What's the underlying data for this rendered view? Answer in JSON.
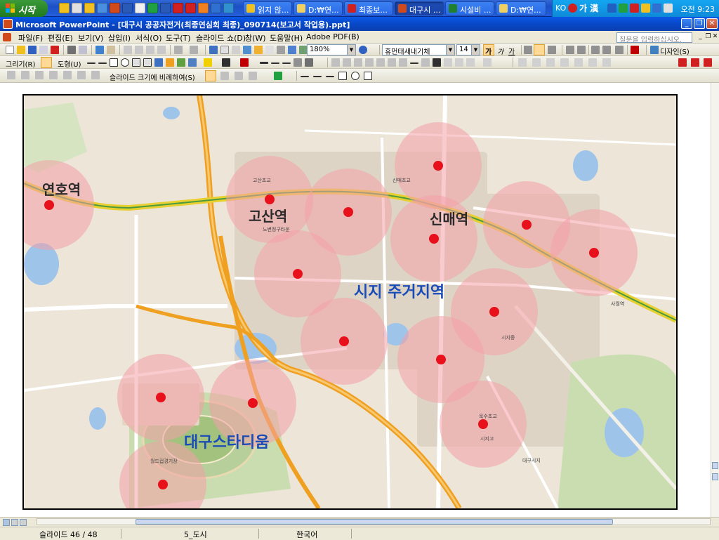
{
  "taskbar": {
    "start_label": "시작",
    "buttons": [
      {
        "label": "읽지 않...",
        "active": false,
        "color": "#f0c020"
      },
      {
        "label": "D:₩연...",
        "active": false,
        "color": "#f0d060"
      },
      {
        "label": "최종보...",
        "active": false,
        "color": "#d02020"
      },
      {
        "label": "대구시 ...",
        "active": true,
        "color": "#d04a1c"
      },
      {
        "label": "시설비 ...",
        "active": false,
        "color": "#208030"
      },
      {
        "label": "D:₩연...",
        "active": false,
        "color": "#f0d060"
      }
    ],
    "ime_label": "KO",
    "ime_mode": "가 漢",
    "clock": "오전 9:23"
  },
  "window": {
    "title": "Microsoft PowerPoint - [대구시 공공자전거(최종연심회 최종)_090714(보고서 작업용).ppt]"
  },
  "menu": {
    "items": [
      "파일(F)",
      "편집(E)",
      "보기(V)",
      "삽입(I)",
      "서식(O)",
      "도구(T)",
      "슬라이드 쇼(D)",
      "창(W)",
      "도움말(H)",
      "Adobe PDF(B)"
    ],
    "help_placeholder": "질문을 입력하십시오."
  },
  "toolbar": {
    "zoom": "180%",
    "font_name": "휴먼태새내기체",
    "font_size": "14",
    "bold_label": "가",
    "italic_label": "가",
    "underline_label": "가",
    "design_label": "디자인(S)",
    "draw_label": "그리기(R)",
    "autoshape_label": "도형(U)",
    "fit_label": "슬라이드 크기에 비례하여(S)"
  },
  "map": {
    "big_labels": [
      {
        "text": "연호역",
        "color": "#2a2a2a"
      },
      {
        "text": "고산역",
        "color": "#2a2a2a"
      },
      {
        "text": "신매역",
        "color": "#2a2a2a"
      },
      {
        "text": "시지 주거지역",
        "color": "#1a4cb8"
      },
      {
        "text": "대구스타디움",
        "color": "#1a4cb8"
      }
    ],
    "small_labels": [
      "고산초교",
      "노변청구타운",
      "신매초교",
      "시지중",
      "대구시지",
      "욱수초교",
      "사월역",
      "시지고",
      "월드컵경기장"
    ],
    "station_count": 16
  },
  "status": {
    "slide": "슬라이드 46 / 48",
    "design": "5_도시",
    "language": "한국어"
  },
  "colors": {
    "accent": "#0a58e6",
    "map_circle": "#f4a0a8",
    "station_dot": "#e8101a",
    "subway_line": "#e8d030",
    "highway": "#f0a020"
  }
}
